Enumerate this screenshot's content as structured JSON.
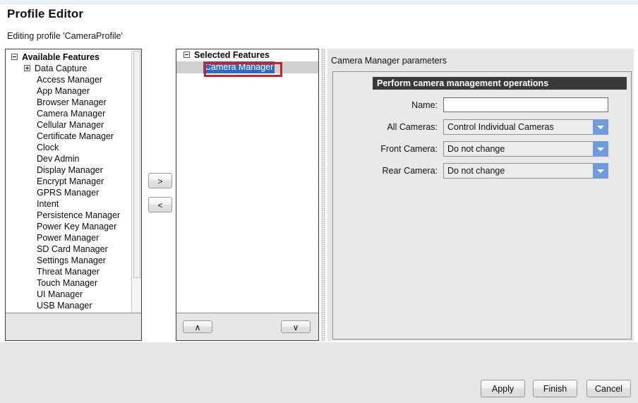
{
  "window": {
    "title": "Profile Editor",
    "subtitle": "Editing profile 'CameraProfile'"
  },
  "available_panel": {
    "root_label": "Available Features",
    "root_toggle": "collapse-box",
    "items": [
      {
        "label": "Data Capture",
        "toggle": "expand-box",
        "level": 1
      },
      {
        "label": "Access Manager",
        "toggle": "",
        "level": 2
      },
      {
        "label": "App Manager",
        "toggle": "",
        "level": 2
      },
      {
        "label": "Browser Manager",
        "toggle": "",
        "level": 2
      },
      {
        "label": "Camera Manager",
        "toggle": "",
        "level": 2
      },
      {
        "label": "Cellular Manager",
        "toggle": "",
        "level": 2
      },
      {
        "label": "Certificate Manager",
        "toggle": "",
        "level": 2
      },
      {
        "label": "Clock",
        "toggle": "",
        "level": 2
      },
      {
        "label": "Dev Admin",
        "toggle": "",
        "level": 2
      },
      {
        "label": "Display Manager",
        "toggle": "",
        "level": 2
      },
      {
        "label": "Encrypt Manager",
        "toggle": "",
        "level": 2
      },
      {
        "label": "GPRS Manager",
        "toggle": "",
        "level": 2
      },
      {
        "label": "Intent",
        "toggle": "",
        "level": 2
      },
      {
        "label": "Persistence Manager",
        "toggle": "",
        "level": 2
      },
      {
        "label": "Power Key Manager",
        "toggle": "",
        "level": 2
      },
      {
        "label": "Power Manager",
        "toggle": "",
        "level": 2
      },
      {
        "label": "SD Card Manager",
        "toggle": "",
        "level": 2
      },
      {
        "label": "Settings Manager",
        "toggle": "",
        "level": 2
      },
      {
        "label": "Threat Manager",
        "toggle": "",
        "level": 2
      },
      {
        "label": "Touch Manager",
        "toggle": "",
        "level": 2
      },
      {
        "label": "UI Manager",
        "toggle": "",
        "level": 2
      },
      {
        "label": "USB Manager",
        "toggle": "",
        "level": 2
      }
    ]
  },
  "transfer": {
    "add_label": ">",
    "remove_label": "<"
  },
  "selected_panel": {
    "root_label": "Selected Features",
    "items": [
      {
        "label": "Camera Manager",
        "selected": true
      }
    ],
    "move_up_label": "∧",
    "move_down_label": "∨"
  },
  "parameters": {
    "title": "Camera Manager parameters",
    "section_header": "Perform camera management operations",
    "fields": [
      {
        "label": "Name:",
        "type": "text",
        "value": "",
        "placeholder": ""
      },
      {
        "label": "All Cameras:",
        "type": "combo",
        "value": "Control Individual Cameras"
      },
      {
        "label": "Front Camera:",
        "type": "combo",
        "value": "Do not change"
      },
      {
        "label": "Rear Camera:",
        "type": "combo",
        "value": "Do not change"
      }
    ]
  },
  "footer": {
    "apply_label": "Apply",
    "finish_label": "Finish",
    "cancel_label": "Cancel"
  },
  "colors": {
    "selection_blue": "#316ac5",
    "annotation_red": "#cc2026",
    "section_header_bg": "#3a3a3a",
    "combo_arrow_blue": "#6f9ddb",
    "panel_bg": "#e6e6e6"
  }
}
